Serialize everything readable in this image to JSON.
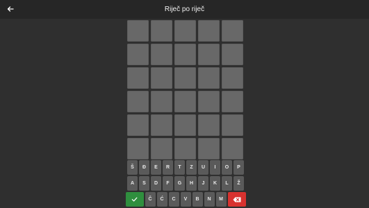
{
  "header": {
    "title": "Riječ po riječ",
    "back_icon": "arrow-left-icon"
  },
  "board": {
    "rows": [
      [
        "",
        "",
        "",
        "",
        ""
      ],
      [
        "",
        "",
        "",
        "",
        ""
      ],
      [
        "",
        "",
        "",
        "",
        ""
      ],
      [
        "",
        "",
        "",
        "",
        ""
      ],
      [
        "",
        "",
        "",
        "",
        ""
      ],
      [
        "",
        "",
        "",
        "",
        ""
      ]
    ]
  },
  "keyboard": {
    "row1": [
      "Š",
      "Đ",
      "E",
      "R",
      "T",
      "Z",
      "U",
      "I",
      "O",
      "P"
    ],
    "row2": [
      "A",
      "S",
      "D",
      "F",
      "G",
      "H",
      "J",
      "K",
      "L",
      "Ž"
    ],
    "row3": [
      "Č",
      "Ć",
      "C",
      "V",
      "B",
      "N",
      "M"
    ],
    "enter_icon": "check-icon",
    "delete_icon": "backspace-icon",
    "colors": {
      "enter": "#2f8f3e",
      "delete": "#d8322f",
      "key": "#5a5a5a",
      "tile": "#686868"
    }
  }
}
